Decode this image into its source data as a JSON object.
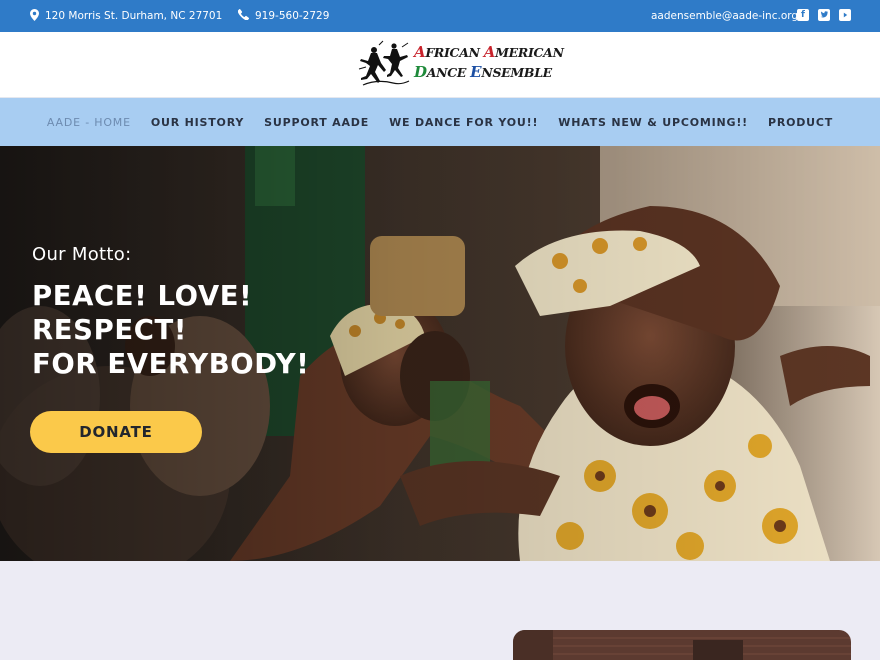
{
  "topbar": {
    "address": "120 Morris St. Durham, NC 27701",
    "phone": "919-560-2729",
    "email": "aadensemble@aade-inc.org",
    "icons": [
      "map-pin-icon",
      "phone-icon",
      "facebook-icon",
      "twitter-icon",
      "youtube-icon"
    ]
  },
  "logo": {
    "line1_a": "A",
    "line1_b": "FRICAN ",
    "line1_c": "A",
    "line1_d": "MERICAN",
    "line2_a": "D",
    "line2_b": "ANCE ",
    "line2_c": "E",
    "line2_d": "NSEMBLE"
  },
  "nav": {
    "items": [
      {
        "label": "AADE - HOME",
        "active": true
      },
      {
        "label": "OUR HISTORY"
      },
      {
        "label": "SUPPORT AADE"
      },
      {
        "label": "WE DANCE FOR YOU!!"
      },
      {
        "label": "WHATS NEW & UPCOMING!!"
      },
      {
        "label": "PRODUCT"
      }
    ]
  },
  "hero": {
    "motto": "Our Motto:",
    "headline_lines": [
      "PEACE! LOVE!",
      "RESPECT!",
      "FOR EVERYBODY!"
    ],
    "donate_label": "DONATE"
  },
  "colors": {
    "topbar": "#2f7bc8",
    "nav": "#a8cdf2",
    "donate": "#fbc94a",
    "page_bg": "#ecebf4"
  }
}
